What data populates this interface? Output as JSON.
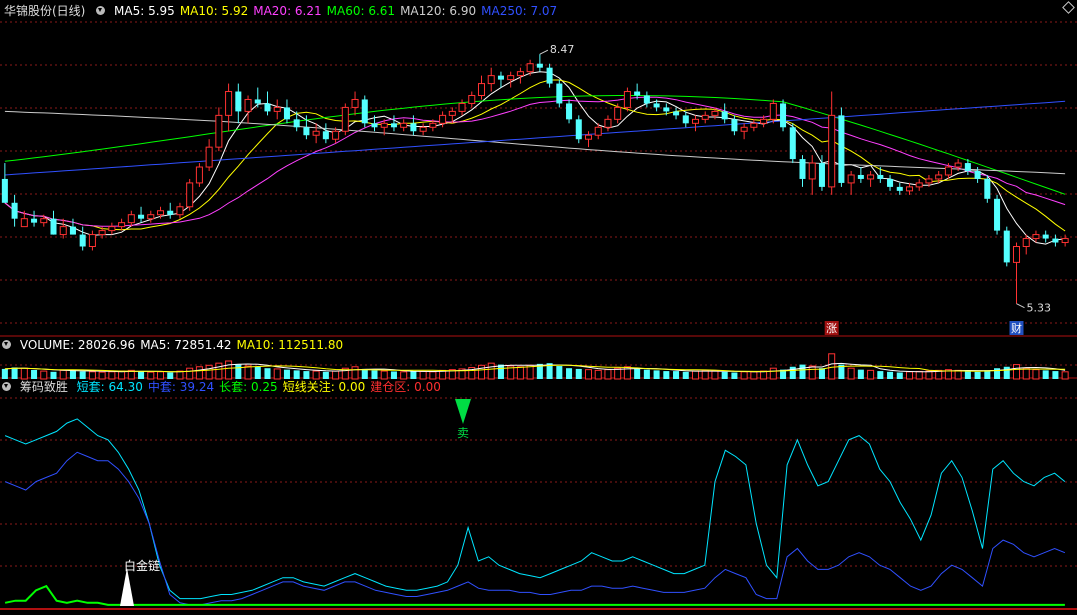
{
  "title": "华锦股份(日线)",
  "ma_legend": [
    {
      "label": "MA5: 5.95",
      "color": "#ffffff"
    },
    {
      "label": "MA10: 5.92",
      "color": "#ffff00"
    },
    {
      "label": "MA20: 6.21",
      "color": "#ff40ff"
    },
    {
      "label": "MA60: 6.61",
      "color": "#00ff00"
    },
    {
      "label": "MA120: 6.90",
      "color": "#cccccc"
    },
    {
      "label": "MA250: 7.07",
      "color": "#3050ff"
    }
  ],
  "volume_legend": [
    {
      "label": "VOLUME: 28026.96",
      "color": "#ffffff"
    },
    {
      "label": "MA5: 72851.42",
      "color": "#ffffff"
    },
    {
      "label": "MA10: 112511.80",
      "color": "#ffff00"
    }
  ],
  "indicator_title": "筹码致胜",
  "indicator_legend": [
    {
      "label": "短套: 64.30",
      "color": "#00e5ff"
    },
    {
      "label": "中套: 39.24",
      "color": "#3050ff"
    },
    {
      "label": "长套: 0.25",
      "color": "#00ff00"
    },
    {
      "label": "短线关注: 0.00",
      "color": "#ffff00"
    },
    {
      "label": "建仓区: 0.00",
      "color": "#ff3030"
    }
  ],
  "annotations": {
    "high": "8.47",
    "low": "5.33",
    "marker_zhang": "涨",
    "marker_cai": "财",
    "signal_sell": "卖",
    "signal_gold": "白金链"
  },
  "colors": {
    "up": "#ff3232",
    "down": "#54ffff",
    "grid": "#8a1a1a",
    "separator": "#b01010",
    "ma5": "#ffffff",
    "ma10": "#ffff00",
    "ma20": "#ff40ff",
    "ma60": "#00ff00",
    "ma120": "#cccccc",
    "ma250": "#3050ff",
    "short": "#00e5ff",
    "mid": "#3050ff",
    "long": "#00ff00"
  },
  "chart_data": [
    {
      "type": "candlestick",
      "title": "华锦股份(日线)",
      "ylim": [
        5.1,
        8.9
      ],
      "candles": [
        [
          6.9,
          7.1,
          6.6,
          6.6
        ],
        [
          6.6,
          6.7,
          6.3,
          6.4
        ],
        [
          6.3,
          6.5,
          6.3,
          6.4
        ],
        [
          6.4,
          6.5,
          6.3,
          6.35
        ],
        [
          6.35,
          6.45,
          6.3,
          6.4
        ],
        [
          6.4,
          6.5,
          6.2,
          6.2
        ],
        [
          6.2,
          6.4,
          6.15,
          6.3
        ],
        [
          6.3,
          6.4,
          6.2,
          6.2
        ],
        [
          6.2,
          6.3,
          6.0,
          6.05
        ],
        [
          6.05,
          6.25,
          6.0,
          6.2
        ],
        [
          6.2,
          6.3,
          6.15,
          6.25
        ],
        [
          6.25,
          6.35,
          6.2,
          6.3
        ],
        [
          6.3,
          6.4,
          6.25,
          6.35
        ],
        [
          6.35,
          6.5,
          6.3,
          6.45
        ],
        [
          6.45,
          6.55,
          6.35,
          6.4
        ],
        [
          6.4,
          6.5,
          6.35,
          6.45
        ],
        [
          6.45,
          6.55,
          6.4,
          6.5
        ],
        [
          6.5,
          6.6,
          6.4,
          6.45
        ],
        [
          6.45,
          6.6,
          6.4,
          6.55
        ],
        [
          6.55,
          6.9,
          6.5,
          6.85
        ],
        [
          6.85,
          7.1,
          6.8,
          7.05
        ],
        [
          7.05,
          7.4,
          7.0,
          7.3
        ],
        [
          7.3,
          7.8,
          7.25,
          7.7
        ],
        [
          7.7,
          8.1,
          7.5,
          8.0
        ],
        [
          8.0,
          8.1,
          7.6,
          7.75
        ],
        [
          7.75,
          7.95,
          7.6,
          7.9
        ],
        [
          7.9,
          8.05,
          7.8,
          7.85
        ],
        [
          7.85,
          8.0,
          7.7,
          7.75
        ],
        [
          7.75,
          7.9,
          7.65,
          7.8
        ],
        [
          7.8,
          7.9,
          7.6,
          7.65
        ],
        [
          7.65,
          7.75,
          7.5,
          7.55
        ],
        [
          7.55,
          7.7,
          7.4,
          7.45
        ],
        [
          7.45,
          7.6,
          7.35,
          7.5
        ],
        [
          7.5,
          7.6,
          7.35,
          7.4
        ],
        [
          7.4,
          7.55,
          7.35,
          7.5
        ],
        [
          7.5,
          7.85,
          7.45,
          7.8
        ],
        [
          7.8,
          8.0,
          7.7,
          7.9
        ],
        [
          7.9,
          7.95,
          7.55,
          7.6
        ],
        [
          7.6,
          7.7,
          7.5,
          7.55
        ],
        [
          7.55,
          7.65,
          7.45,
          7.6
        ],
        [
          7.6,
          7.7,
          7.5,
          7.55
        ],
        [
          7.55,
          7.65,
          7.5,
          7.6
        ],
        [
          7.6,
          7.7,
          7.45,
          7.5
        ],
        [
          7.5,
          7.6,
          7.45,
          7.55
        ],
        [
          7.55,
          7.65,
          7.5,
          7.6
        ],
        [
          7.6,
          7.75,
          7.55,
          7.7
        ],
        [
          7.7,
          7.8,
          7.6,
          7.75
        ],
        [
          7.75,
          7.9,
          7.7,
          7.85
        ],
        [
          7.85,
          8.0,
          7.8,
          7.95
        ],
        [
          7.95,
          8.2,
          7.9,
          8.1
        ],
        [
          8.1,
          8.3,
          8.0,
          8.2
        ],
        [
          8.2,
          8.25,
          8.05,
          8.15
        ],
        [
          8.15,
          8.25,
          8.05,
          8.2
        ],
        [
          8.2,
          8.3,
          8.1,
          8.25
        ],
        [
          8.25,
          8.4,
          8.2,
          8.35
        ],
        [
          8.35,
          8.47,
          8.25,
          8.3
        ],
        [
          8.3,
          8.35,
          8.05,
          8.1
        ],
        [
          8.1,
          8.15,
          7.8,
          7.85
        ],
        [
          7.85,
          7.9,
          7.6,
          7.65
        ],
        [
          7.65,
          7.7,
          7.35,
          7.4
        ],
        [
          7.4,
          7.5,
          7.3,
          7.45
        ],
        [
          7.45,
          7.6,
          7.4,
          7.55
        ],
        [
          7.55,
          7.7,
          7.5,
          7.65
        ],
        [
          7.65,
          7.85,
          7.6,
          7.8
        ],
        [
          7.8,
          8.05,
          7.75,
          8.0
        ],
        [
          8.0,
          8.1,
          7.9,
          7.95
        ],
        [
          7.95,
          8.0,
          7.8,
          7.85
        ],
        [
          7.85,
          7.9,
          7.75,
          7.8
        ],
        [
          7.8,
          7.85,
          7.7,
          7.75
        ],
        [
          7.75,
          7.8,
          7.65,
          7.7
        ],
        [
          7.7,
          7.75,
          7.55,
          7.6
        ],
        [
          7.6,
          7.7,
          7.5,
          7.65
        ],
        [
          7.65,
          7.75,
          7.6,
          7.7
        ],
        [
          7.7,
          7.8,
          7.65,
          7.75
        ],
        [
          7.75,
          7.85,
          7.6,
          7.65
        ],
        [
          7.65,
          7.7,
          7.45,
          7.5
        ],
        [
          7.5,
          7.6,
          7.4,
          7.55
        ],
        [
          7.55,
          7.65,
          7.5,
          7.6
        ],
        [
          7.6,
          7.7,
          7.55,
          7.65
        ],
        [
          7.65,
          7.9,
          7.6,
          7.85
        ],
        [
          7.85,
          7.9,
          7.5,
          7.55
        ],
        [
          7.55,
          7.6,
          7.1,
          7.15
        ],
        [
          7.15,
          7.2,
          6.8,
          6.9
        ],
        [
          6.9,
          7.2,
          6.7,
          7.1
        ],
        [
          7.1,
          7.2,
          6.75,
          6.8
        ],
        [
          6.8,
          8.0,
          6.7,
          7.7
        ],
        [
          7.7,
          7.8,
          6.8,
          6.85
        ],
        [
          6.85,
          7.0,
          6.7,
          6.95
        ],
        [
          6.95,
          7.05,
          6.85,
          6.9
        ],
        [
          6.9,
          7.0,
          6.8,
          6.95
        ],
        [
          6.95,
          7.05,
          6.85,
          6.9
        ],
        [
          6.9,
          6.95,
          6.75,
          6.8
        ],
        [
          6.8,
          6.85,
          6.7,
          6.75
        ],
        [
          6.75,
          6.85,
          6.7,
          6.8
        ],
        [
          6.8,
          6.9,
          6.75,
          6.85
        ],
        [
          6.85,
          6.95,
          6.8,
          6.9
        ],
        [
          6.9,
          7.0,
          6.85,
          6.95
        ],
        [
          6.95,
          7.1,
          6.9,
          7.05
        ],
        [
          7.05,
          7.15,
          7.0,
          7.1
        ],
        [
          7.1,
          7.15,
          6.95,
          7.0
        ],
        [
          7.0,
          7.05,
          6.85,
          6.9
        ],
        [
          6.9,
          6.95,
          6.6,
          6.65
        ],
        [
          6.65,
          6.7,
          6.2,
          6.25
        ],
        [
          6.25,
          6.3,
          5.8,
          5.85
        ],
        [
          5.85,
          6.1,
          5.33,
          6.05
        ],
        [
          6.05,
          6.2,
          5.95,
          6.15
        ],
        [
          6.15,
          6.25,
          6.1,
          6.2
        ],
        [
          6.2,
          6.25,
          6.1,
          6.15
        ],
        [
          6.15,
          6.2,
          6.05,
          6.1
        ],
        [
          6.1,
          6.2,
          6.05,
          6.15
        ]
      ]
    },
    {
      "type": "bar",
      "title": "VOLUME",
      "values": [
        28,
        32,
        30,
        25,
        22,
        20,
        24,
        26,
        21,
        20,
        19,
        20,
        22,
        24,
        21,
        19,
        20,
        18,
        22,
        30,
        34,
        38,
        44,
        50,
        40,
        36,
        34,
        30,
        28,
        26,
        24,
        22,
        22,
        20,
        22,
        30,
        34,
        28,
        24,
        22,
        21,
        20,
        22,
        21,
        20,
        24,
        26,
        28,
        32,
        38,
        44,
        40,
        36,
        34,
        38,
        42,
        44,
        36,
        30,
        28,
        26,
        24,
        26,
        30,
        34,
        30,
        26,
        24,
        22,
        22,
        20,
        22,
        24,
        22,
        20,
        18,
        20,
        20,
        22,
        30,
        26,
        34,
        40,
        36,
        30,
        70,
        40,
        30,
        26,
        24,
        22,
        20,
        18,
        20,
        21,
        22,
        24,
        26,
        24,
        22,
        20,
        24,
        30,
        34,
        40,
        30,
        26,
        24,
        22,
        20
      ],
      "ylim": [
        0,
        75
      ]
    },
    {
      "type": "line",
      "title": "筹码致胜",
      "ylim": [
        0,
        100
      ],
      "series": [
        {
          "name": "短套",
          "values": [
            82,
            80,
            78,
            80,
            82,
            84,
            88,
            90,
            86,
            82,
            80,
            74,
            66,
            56,
            40,
            20,
            8,
            4,
            4,
            4,
            5,
            6,
            6,
            7,
            8,
            10,
            12,
            14,
            14,
            12,
            11,
            10,
            12,
            14,
            16,
            14,
            12,
            10,
            9,
            8,
            8,
            9,
            10,
            12,
            20,
            38,
            22,
            24,
            20,
            18,
            16,
            15,
            14,
            16,
            18,
            20,
            22,
            26,
            24,
            22,
            22,
            24,
            22,
            20,
            18,
            16,
            16,
            18,
            20,
            60,
            75,
            72,
            68,
            40,
            20,
            14,
            68,
            80,
            68,
            58,
            60,
            70,
            80,
            82,
            78,
            66,
            60,
            50,
            42,
            32,
            44,
            64,
            70,
            62,
            46,
            28,
            66,
            70,
            64,
            60,
            58,
            62,
            64,
            60
          ],
          "_note": ""
        },
        {
          "name": "中套",
          "values": [
            60,
            58,
            56,
            60,
            62,
            64,
            70,
            74,
            72,
            70,
            70,
            66,
            60,
            52,
            40,
            22,
            6,
            2,
            1,
            1,
            2,
            3,
            3,
            4,
            6,
            8,
            10,
            12,
            12,
            10,
            9,
            8,
            10,
            12,
            12,
            10,
            8,
            7,
            6,
            5,
            5,
            6,
            7,
            8,
            10,
            12,
            9,
            8,
            8,
            8,
            7,
            7,
            6,
            6,
            7,
            8,
            8,
            10,
            10,
            9,
            9,
            10,
            9,
            8,
            7,
            7,
            7,
            8,
            9,
            14,
            18,
            16,
            14,
            6,
            4,
            4,
            24,
            28,
            22,
            18,
            18,
            20,
            24,
            26,
            24,
            20,
            18,
            14,
            10,
            8,
            10,
            16,
            20,
            18,
            14,
            10,
            28,
            32,
            30,
            26,
            24,
            26,
            28,
            26
          ]
        },
        {
          "name": "长套",
          "values": [
            2,
            3,
            3,
            8,
            10,
            3,
            2,
            3,
            2,
            2,
            1,
            1,
            1,
            1,
            1,
            1,
            1,
            1,
            1,
            1,
            1,
            1,
            1,
            1,
            1,
            1,
            1,
            1,
            1,
            1,
            1,
            1,
            1,
            1,
            1,
            1,
            1,
            1,
            1,
            1,
            1,
            1,
            1,
            1,
            1,
            1,
            1,
            1,
            1,
            1,
            1,
            1,
            1,
            1,
            1,
            1,
            1,
            1,
            1,
            1,
            1,
            1,
            1,
            1,
            1,
            1,
            1,
            1,
            1,
            1,
            1,
            1,
            1,
            1,
            1,
            1,
            1,
            1,
            1,
            1,
            1,
            1,
            1,
            1,
            1,
            1,
            1,
            1,
            1,
            1,
            1,
            1,
            1,
            1,
            1,
            1,
            1,
            1,
            1,
            1,
            1,
            1,
            1,
            1
          ]
        }
      ]
    }
  ]
}
